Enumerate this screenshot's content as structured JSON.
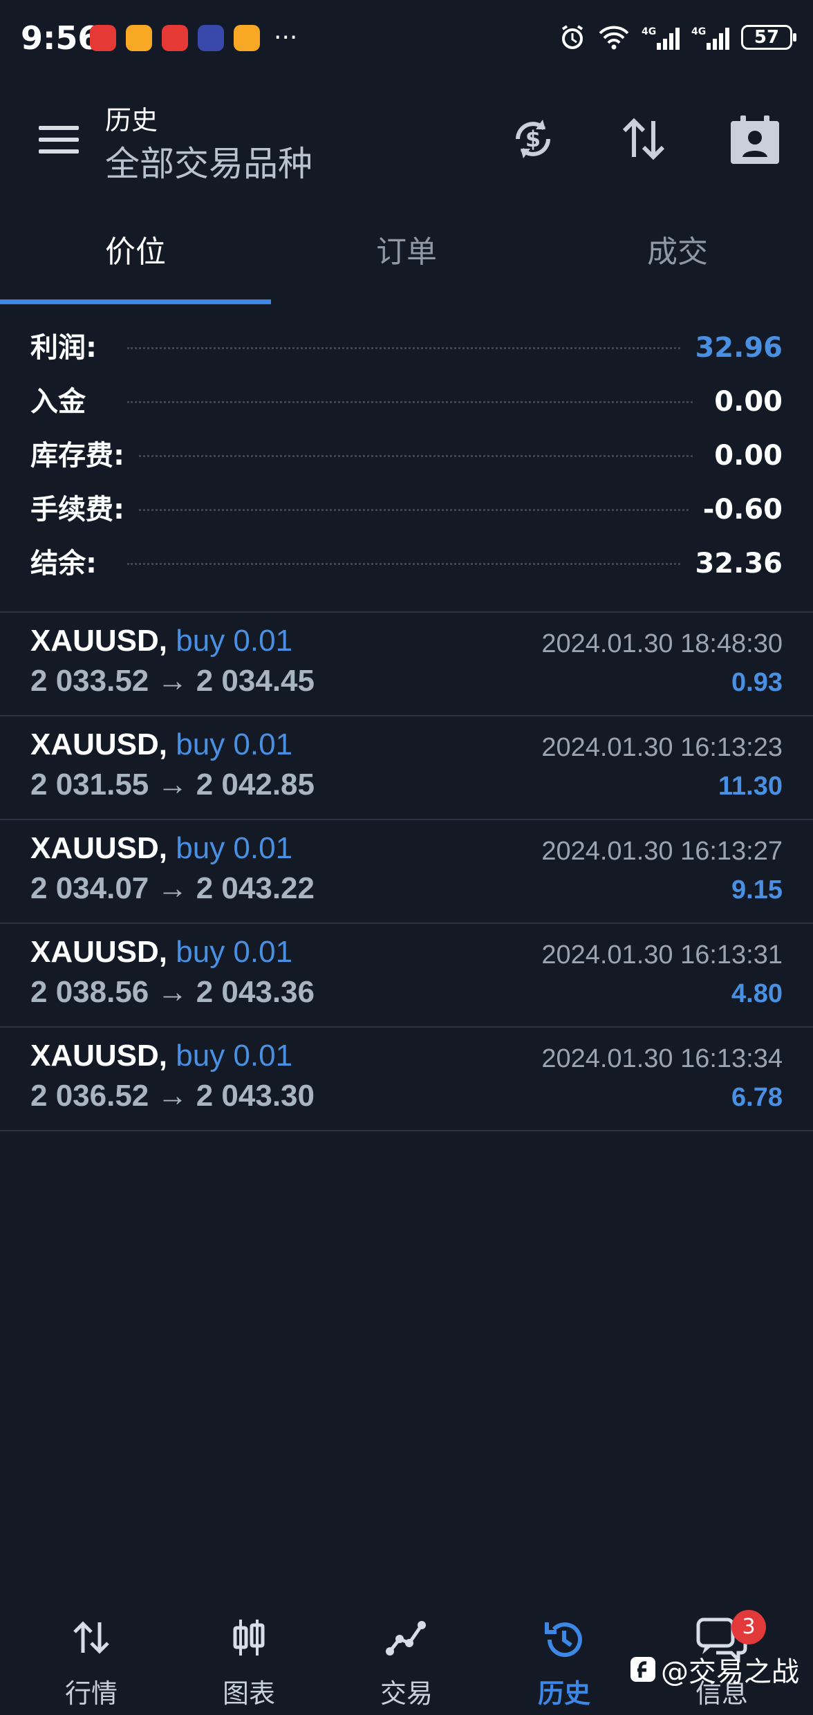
{
  "status_bar": {
    "time": "9:56",
    "more": "···",
    "battery": "57",
    "app_colors": [
      "#e53935",
      "#f9a825",
      "#e53935",
      "#3949ab",
      "#f9a825"
    ]
  },
  "header": {
    "title": "历史",
    "subtitle": "全部交易品种"
  },
  "tabs": [
    {
      "label": "价位",
      "active": true
    },
    {
      "label": "订单",
      "active": false
    },
    {
      "label": "成交",
      "active": false
    }
  ],
  "summary": [
    {
      "label": "利润:",
      "value": "32.96",
      "color": "#4a90e2"
    },
    {
      "label": "入金",
      "value": "0.00",
      "color": "#ffffff"
    },
    {
      "label": "库存费:",
      "value": "0.00",
      "color": "#ffffff"
    },
    {
      "label": "手续费:",
      "value": "-0.60",
      "color": "#ffffff"
    },
    {
      "label": "结余:",
      "value": "32.36",
      "color": "#ffffff"
    }
  ],
  "trades": [
    {
      "symbol": "XAUUSD,",
      "side": "buy 0.01",
      "prices": "2 033.52 → 2 034.45",
      "time": "2024.01.30 18:48:30",
      "profit": "0.93"
    },
    {
      "symbol": "XAUUSD,",
      "side": "buy 0.01",
      "prices": "2 031.55 → 2 042.85",
      "time": "2024.01.30 16:13:23",
      "profit": "11.30"
    },
    {
      "symbol": "XAUUSD,",
      "side": "buy 0.01",
      "prices": "2 034.07 → 2 043.22",
      "time": "2024.01.30 16:13:27",
      "profit": "9.15"
    },
    {
      "symbol": "XAUUSD,",
      "side": "buy 0.01",
      "prices": "2 038.56 → 2 043.36",
      "time": "2024.01.30 16:13:31",
      "profit": "4.80"
    },
    {
      "symbol": "XAUUSD,",
      "side": "buy 0.01",
      "prices": "2 036.52 → 2 043.30",
      "time": "2024.01.30 16:13:34",
      "profit": "6.78"
    }
  ],
  "nav": [
    {
      "label": "行情",
      "icon": "quotes-icon",
      "active": false
    },
    {
      "label": "图表",
      "icon": "chart-icon",
      "active": false
    },
    {
      "label": "交易",
      "icon": "trade-icon",
      "active": false
    },
    {
      "label": "历史",
      "icon": "history-icon",
      "active": true
    },
    {
      "label": "信息",
      "icon": "messages-icon",
      "active": false,
      "badge": "3"
    }
  ],
  "watermark": "@交易之战",
  "colors": {
    "background": "#131a26",
    "accent": "#3d87e6",
    "badge": "#e23a3a"
  }
}
